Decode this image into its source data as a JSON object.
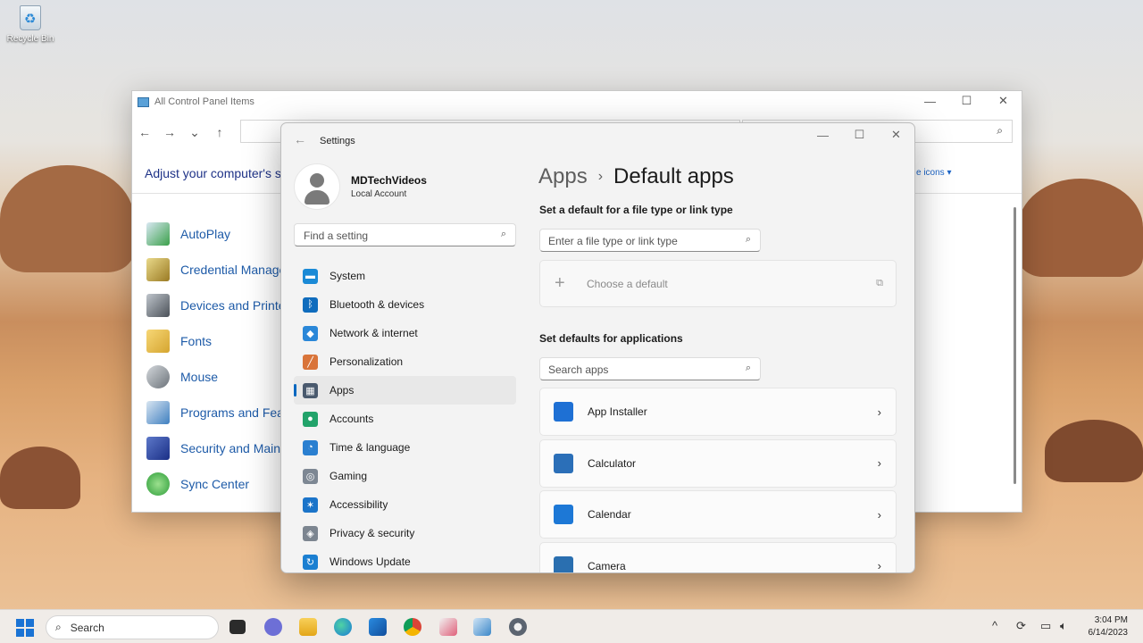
{
  "desktop": {
    "recycle_bin": "Recycle Bin"
  },
  "control_panel": {
    "title": "All Control Panel Items",
    "heading": "Adjust your computer's s",
    "view_by": "e icons ▾",
    "items": [
      "AutoPlay",
      "Credential Manage",
      "Devices and Printe",
      "Fonts",
      "Mouse",
      "Programs and Fea",
      "Security and Main",
      "Sync Center"
    ]
  },
  "settings": {
    "window_title": "Settings",
    "user": {
      "name": "MDTechVideos",
      "account": "Local Account"
    },
    "find_placeholder": "Find a setting",
    "nav": [
      {
        "label": "System",
        "icon": "system-icon",
        "color": "#1a8ad6"
      },
      {
        "label": "Bluetooth & devices",
        "icon": "bluetooth-icon",
        "color": "#0f6cbd"
      },
      {
        "label": "Network & internet",
        "icon": "wifi-icon",
        "color": "#2a87d8"
      },
      {
        "label": "Personalization",
        "icon": "brush-icon",
        "color": "#d9743a"
      },
      {
        "label": "Apps",
        "icon": "apps-icon",
        "color": "#4a5a6e"
      },
      {
        "label": "Accounts",
        "icon": "accounts-icon",
        "color": "#22a36a"
      },
      {
        "label": "Time & language",
        "icon": "globe-clock-icon",
        "color": "#2a7fd0"
      },
      {
        "label": "Gaming",
        "icon": "gamepad-icon",
        "color": "#7d8793"
      },
      {
        "label": "Accessibility",
        "icon": "accessibility-icon",
        "color": "#1b74c9"
      },
      {
        "label": "Privacy & security",
        "icon": "shield-icon",
        "color": "#7c8590"
      },
      {
        "label": "Windows Update",
        "icon": "update-icon",
        "color": "#1b7fd1"
      }
    ],
    "active_nav": "Apps",
    "breadcrumb_parent": "Apps",
    "breadcrumb_current": "Default apps",
    "section_filetype": "Set a default for a file type or link type",
    "filetype_placeholder": "Enter a file type or link type",
    "choose_default": "Choose a default",
    "section_apps": "Set defaults for applications",
    "apps_placeholder": "Search apps",
    "apps": [
      {
        "label": "App Installer",
        "icon": "app-installer-icon",
        "color": "#1e70d4"
      },
      {
        "label": "Calculator",
        "icon": "calculator-icon",
        "color": "#2b6fb8"
      },
      {
        "label": "Calendar",
        "icon": "calendar-icon",
        "color": "#1d78d6"
      },
      {
        "label": "Camera",
        "icon": "camera-icon",
        "color": "#2a6fb0"
      }
    ]
  },
  "taskbar": {
    "search_label": "Search",
    "time": "3:04 PM",
    "date": "6/14/2023"
  }
}
